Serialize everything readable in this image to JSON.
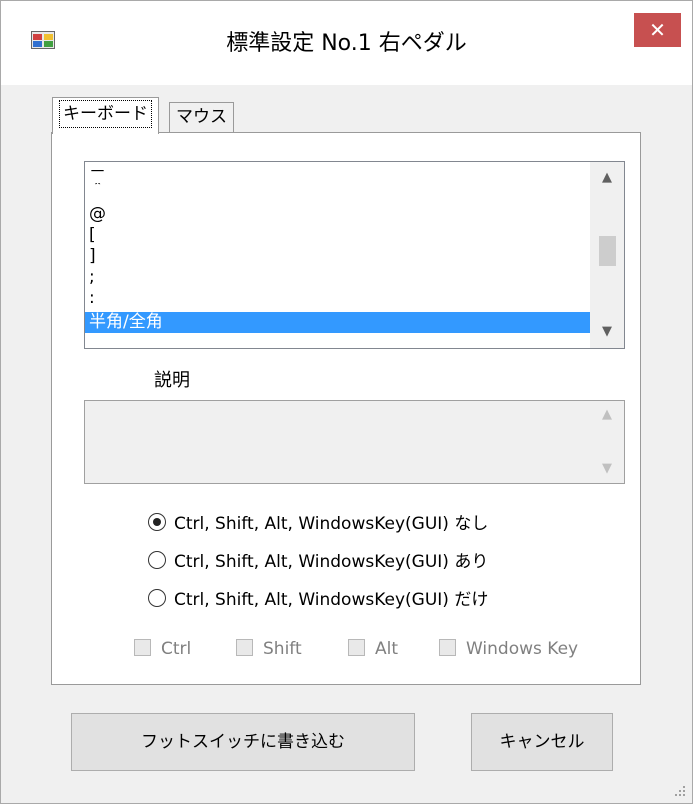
{
  "window": {
    "title": "標準設定 No.1 右ペダル",
    "close_glyph": "✕",
    "app_icon": "app-window-icon"
  },
  "tabs": [
    {
      "label": "キーボード",
      "selected": true
    },
    {
      "label": "マウス",
      "selected": false
    }
  ],
  "key_list": {
    "items": [
      "－",
      "＾",
      "@",
      "[",
      "]",
      ";",
      ":",
      "半角/全角"
    ],
    "selected_item": "半角/全角",
    "scroll_up_glyph": "▲",
    "scroll_down_glyph": "▼"
  },
  "description": {
    "label": "説明",
    "value": "",
    "scroll_up_glyph": "▲",
    "scroll_down_glyph": "▼"
  },
  "modifier_mode": {
    "options": [
      {
        "label": "Ctrl, Shift, Alt, WindowsKey(GUI) なし",
        "checked": true
      },
      {
        "label": "Ctrl, Shift, Alt, WindowsKey(GUI) あり",
        "checked": false
      },
      {
        "label": "Ctrl, Shift, Alt, WindowsKey(GUI) だけ",
        "checked": false
      }
    ]
  },
  "modifier_keys": [
    {
      "label": "Ctrl",
      "checked": false,
      "enabled": false
    },
    {
      "label": "Shift",
      "checked": false,
      "enabled": false
    },
    {
      "label": "Alt",
      "checked": false,
      "enabled": false
    },
    {
      "label": "Windows Key",
      "checked": false,
      "enabled": false
    }
  ],
  "buttons": {
    "write": "フットスイッチに書き込む",
    "cancel": "キャンセル"
  },
  "colors": {
    "selection": "#3399ff",
    "close_button": "#c75050",
    "window_bg": "#f0f0f0"
  }
}
